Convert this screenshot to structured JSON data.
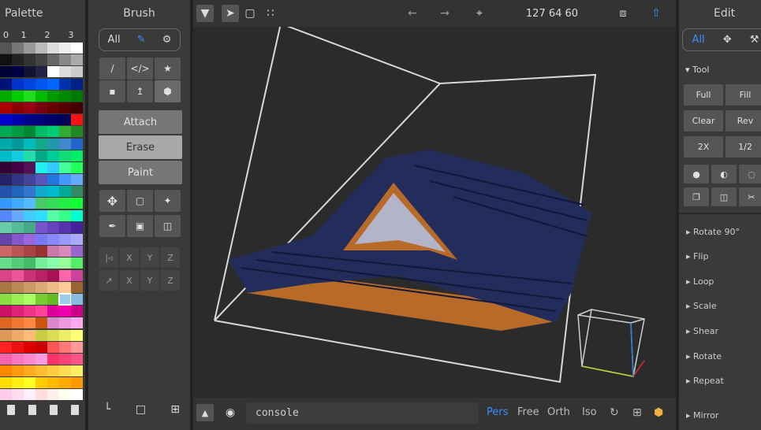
{
  "palette": {
    "title": "Palette",
    "col_headers": [
      "0",
      "1",
      "2",
      "3"
    ],
    "rows": [
      [
        "#555555",
        "#777777",
        "#999999",
        "#bbbbbb",
        "#dddddd",
        "#eeeeee",
        "#ffffff"
      ],
      [
        "#111111",
        "#222222",
        "#333333",
        "#444444",
        "#666666",
        "#888888",
        "#aaaaaa"
      ],
      [
        "#000033",
        "#000044",
        "#111133",
        "#222244",
        "#ffffff",
        "#dddddd",
        "#cccccc"
      ],
      [
        "#001177",
        "#0033cc",
        "#0044dd",
        "#0055ee",
        "#0066ff",
        "#0033aa",
        "#002288"
      ],
      [
        "#00aa00",
        "#00cc00",
        "#22dd22",
        "#00bb00",
        "#009900",
        "#008800",
        "#007700"
      ],
      [
        "#aa0000",
        "#880000",
        "#990011",
        "#770011",
        "#660000",
        "#550000",
        "#440000"
      ],
      [
        "#0000cc",
        "#0000aa",
        "#000088",
        "#000077",
        "#000066",
        "#000055",
        "#ff1111"
      ],
      [
        "#00aa55",
        "#009944",
        "#008833",
        "#00bb66",
        "#00cc77",
        "#33aa33",
        "#228822"
      ],
      [
        "#00aaaa",
        "#009999",
        "#00bbbb",
        "#11aa88",
        "#2299aa",
        "#4488cc",
        "#2266cc"
      ],
      [
        "#00bbcc",
        "#11ccdd",
        "#22ddaa",
        "#00aa88",
        "#00cc99",
        "#11dd77",
        "#00ee66"
      ],
      [
        "#330033",
        "#440044",
        "#551155",
        "#22eeee",
        "#33ccff",
        "#44ff99",
        "#22ff55"
      ],
      [
        "#222266",
        "#333388",
        "#444499",
        "#5555bb",
        "#2277dd",
        "#4499ff",
        "#66aaff"
      ],
      [
        "#2255aa",
        "#2266bb",
        "#3377cc",
        "#11aacc",
        "#00bbcc",
        "#00aa99",
        "#338866"
      ],
      [
        "#3399ff",
        "#44aaff",
        "#55bbff",
        "#44cc66",
        "#33dd55",
        "#22ee44",
        "#11ff33"
      ],
      [
        "#5588ff",
        "#66aaff",
        "#44ccff",
        "#33ddff",
        "#55ffaa",
        "#33ff88",
        "#00ffcc"
      ],
      [
        "#66ccaa",
        "#55bb99",
        "#44aa88",
        "#7755cc",
        "#6644bb",
        "#5533aa",
        "#442299"
      ],
      [
        "#6644aa",
        "#8855cc",
        "#9966dd",
        "#7777ff",
        "#8888ff",
        "#9999ff",
        "#aaaaff"
      ],
      [
        "#cc6666",
        "#bb5555",
        "#aa4444",
        "#993333",
        "#cc77aa",
        "#dd88bb",
        "#9966cc"
      ],
      [
        "#66dd88",
        "#55cc77",
        "#44bb66",
        "#77ee99",
        "#88ffaa",
        "#99ff99",
        "#55ee66"
      ],
      [
        "#dd4488",
        "#ee5599",
        "#cc3377",
        "#bb2266",
        "#aa1155",
        "#ff66aa",
        "#cc4499"
      ],
      [
        "#aa7744",
        "#bb8855",
        "#cc9966",
        "#ddaa77",
        "#eebb88",
        "#ffcc99",
        "#996633"
      ],
      [
        "#88dd44",
        "#99ee55",
        "#aaff66",
        "#77cc33",
        "#66bb22",
        "#99ccee",
        "#88bbdd"
      ],
      [
        "#cc1166",
        "#dd2277",
        "#ee3388",
        "#ff4499",
        "#dd0099",
        "#ee00aa",
        "#cc0088"
      ],
      [
        "#dd6622",
        "#ee7733",
        "#ff8844",
        "#cc5511",
        "#dd88cc",
        "#ee99dd",
        "#ffaaee"
      ],
      [
        "#dd9955",
        "#eeaa66",
        "#ffbb77",
        "#cccc44",
        "#dddd55",
        "#eeee66",
        "#ffff77"
      ],
      [
        "#ff2222",
        "#ee1111",
        "#dd0000",
        "#cc0000",
        "#ff5555",
        "#ff7777",
        "#ff9999"
      ],
      [
        "#ff66aa",
        "#ff77bb",
        "#ff88cc",
        "#ff99dd",
        "#ff3366",
        "#ff4477",
        "#ff5588"
      ],
      [
        "#ff8800",
        "#ff9911",
        "#ffaa22",
        "#ffbb33",
        "#ffcc44",
        "#ffdd55",
        "#ffee66"
      ],
      [
        "#ffdd00",
        "#ffee11",
        "#ffff22",
        "#ffcc00",
        "#ffbb00",
        "#ffaa00",
        "#ff9900"
      ],
      [
        "#ffccee",
        "#ffddee",
        "#ffeeff",
        "#ffdddd",
        "#ffeeee",
        "#ffffee",
        "#ffffff"
      ]
    ],
    "selected": {
      "row": 21,
      "col": 5
    }
  },
  "brush": {
    "title": "Brush",
    "mode_all": "All",
    "attach": "Attach",
    "erase": "Erase",
    "paint": "Paint",
    "axis_x": "X",
    "axis_y": "Y",
    "axis_z": "Z"
  },
  "toolbar": {
    "coords": "127  64  60"
  },
  "edit": {
    "title": "Edit",
    "mode_all": "All",
    "tool_header": "Tool",
    "full": "Full",
    "fill": "Fill",
    "clear": "Clear",
    "rev": "Rev",
    "x2": "2X",
    "half": "1/2",
    "sections": [
      "Rotate 90°",
      "Flip",
      "Loop",
      "Scale",
      "Shear",
      "Rotate",
      "Repeat",
      "Mirror"
    ]
  },
  "bottom": {
    "console": "console",
    "pers": "Pers",
    "free": "Free",
    "orth": "Orth",
    "iso": "Iso"
  },
  "colors": {
    "accent": "#3a8fff",
    "panel": "#3a3a3a",
    "viewport": "#2b2b2b",
    "roof_blue": "#232d5c",
    "roof_wood": "#b86a28",
    "gable": "#b4b4c8"
  }
}
